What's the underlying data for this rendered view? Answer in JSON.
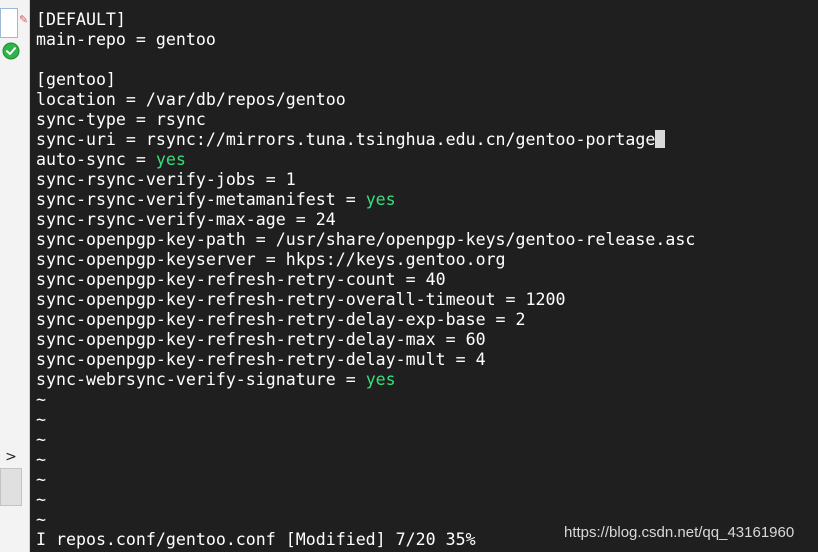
{
  "terminal": {
    "lines": [
      {
        "key": "[DEFAULT]",
        "value": "",
        "value_color": ""
      },
      {
        "key": "main-repo = gentoo",
        "value": "",
        "value_color": ""
      },
      {
        "key": "",
        "value": "",
        "value_color": ""
      },
      {
        "key": "[gentoo]",
        "value": "",
        "value_color": ""
      },
      {
        "key": "location = /var/db/repos/gentoo",
        "value": "",
        "value_color": ""
      },
      {
        "key": "sync-type = rsync",
        "value": "",
        "value_color": ""
      },
      {
        "key": "sync-uri = rsync://mirrors.tuna.tsinghua.edu.cn/gentoo-portage",
        "value": "",
        "value_color": "",
        "cursor": true
      },
      {
        "key": "auto-sync = ",
        "value": "yes",
        "value_color": "green"
      },
      {
        "key": "sync-rsync-verify-jobs = 1",
        "value": "",
        "value_color": ""
      },
      {
        "key": "sync-rsync-verify-metamanifest = ",
        "value": "yes",
        "value_color": "green"
      },
      {
        "key": "sync-rsync-verify-max-age = 24",
        "value": "",
        "value_color": ""
      },
      {
        "key": "sync-openpgp-key-path = /usr/share/openpgp-keys/gentoo-release.asc",
        "value": "",
        "value_color": ""
      },
      {
        "key": "sync-openpgp-keyserver = hkps://keys.gentoo.org",
        "value": "",
        "value_color": ""
      },
      {
        "key": "sync-openpgp-key-refresh-retry-count = 40",
        "value": "",
        "value_color": ""
      },
      {
        "key": "sync-openpgp-key-refresh-retry-overall-timeout = 1200",
        "value": "",
        "value_color": ""
      },
      {
        "key": "sync-openpgp-key-refresh-retry-delay-exp-base = 2",
        "value": "",
        "value_color": ""
      },
      {
        "key": "sync-openpgp-key-refresh-retry-delay-max = 60",
        "value": "",
        "value_color": ""
      },
      {
        "key": "sync-openpgp-key-refresh-retry-delay-mult = 4",
        "value": "",
        "value_color": ""
      },
      {
        "key": "sync-webrsync-verify-signature = ",
        "value": "yes",
        "value_color": "green"
      },
      {
        "key": "~",
        "value": "",
        "value_color": ""
      },
      {
        "key": "~",
        "value": "",
        "value_color": ""
      },
      {
        "key": "~",
        "value": "",
        "value_color": ""
      },
      {
        "key": "~",
        "value": "",
        "value_color": ""
      },
      {
        "key": "~",
        "value": "",
        "value_color": ""
      },
      {
        "key": "~",
        "value": "",
        "value_color": ""
      },
      {
        "key": "~",
        "value": "",
        "value_color": ""
      }
    ],
    "status": "I repos.conf/gentoo.conf [Modified] 7/20 35%",
    "watermark": "https://blog.csdn.net/qq_43161960",
    "colors": {
      "background": "#1f1f1f",
      "text": "#ffffff",
      "keyword": "#35e07a"
    }
  },
  "left_panel": {
    "icons": [
      "pen-icon",
      "check-circle-icon",
      "chevron-right-icon"
    ],
    "chevron_glyph": ">"
  }
}
